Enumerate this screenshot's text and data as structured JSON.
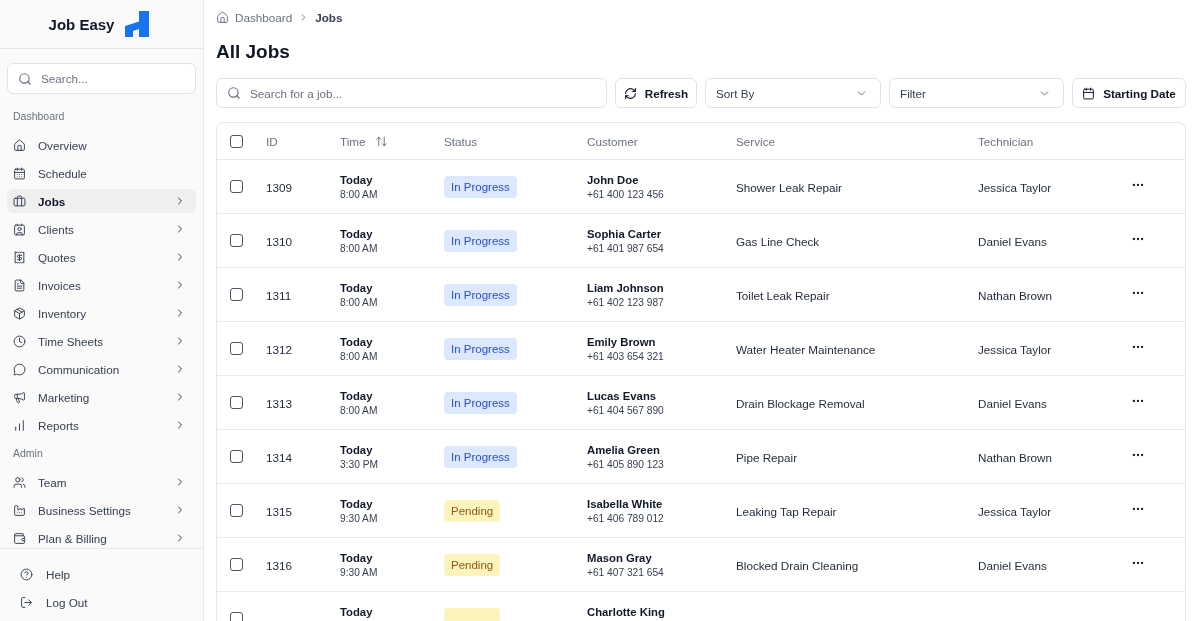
{
  "sidebar": {
    "logo": {
      "text": "Job Easy"
    },
    "search": {
      "placeholder": "Search..."
    },
    "sections": [
      {
        "title": "Dashboard",
        "items": [
          {
            "label": "Overview",
            "selected": false,
            "expandable": false
          },
          {
            "label": "Schedule",
            "selected": false,
            "expandable": false
          },
          {
            "label": "Jobs",
            "selected": true,
            "expandable": true
          },
          {
            "label": "Clients",
            "selected": false,
            "expandable": true
          },
          {
            "label": "Quotes",
            "selected": false,
            "expandable": true
          },
          {
            "label": "Invoices",
            "selected": false,
            "expandable": true
          },
          {
            "label": "Inventory",
            "selected": false,
            "expandable": true
          },
          {
            "label": "Time Sheets",
            "selected": false,
            "expandable": true
          },
          {
            "label": "Communication",
            "selected": false,
            "expandable": true
          },
          {
            "label": "Marketing",
            "selected": false,
            "expandable": true
          },
          {
            "label": "Reports",
            "selected": false,
            "expandable": true
          }
        ]
      },
      {
        "title": "Admin",
        "items": [
          {
            "label": "Team",
            "selected": false,
            "expandable": true
          },
          {
            "label": "Business Settings",
            "selected": false,
            "expandable": true
          },
          {
            "label": "Plan & Billing",
            "selected": false,
            "expandable": true
          }
        ]
      }
    ],
    "footer": [
      {
        "label": "Help"
      },
      {
        "label": "Log Out"
      }
    ]
  },
  "breadcrumb": [
    {
      "label": "Dashboard",
      "current": false
    },
    {
      "label": "Jobs",
      "current": true
    }
  ],
  "page_title": "All Jobs",
  "toolbar": {
    "search": {
      "placeholder": "Search for a job..."
    },
    "refresh_button": "Refresh",
    "sort_select": {
      "placeholder": "Sort By"
    },
    "filter_select": {
      "placeholder": "Filter"
    },
    "date_button": "Starting Date"
  },
  "table": {
    "header_checked": false,
    "columns": [
      {
        "label": "ID",
        "sortable": false
      },
      {
        "label": "Time",
        "sortable": true
      },
      {
        "label": "Status",
        "sortable": false
      },
      {
        "label": "Customer",
        "sortable": false
      },
      {
        "label": "Service",
        "sortable": false
      },
      {
        "label": "Technician",
        "sortable": false
      }
    ],
    "rows": [
      {
        "checked": false,
        "id": "1309",
        "day": "Today",
        "time": "8:00 AM",
        "status": {
          "label": "In Progress",
          "kind": "in_progress"
        },
        "customer": "John Doe",
        "phone": "+61 400 123 456",
        "service": "Shower Leak Repair",
        "technician": "Jessica Taylor"
      },
      {
        "checked": false,
        "id": "1310",
        "day": "Today",
        "time": "8:00 AM",
        "status": {
          "label": "In Progress",
          "kind": "in_progress"
        },
        "customer": "Sophia Carter",
        "phone": "+61 401 987 654",
        "service": "Gas Line Check",
        "technician": "Daniel Evans"
      },
      {
        "checked": false,
        "id": "1311",
        "day": "Today",
        "time": "8:00 AM",
        "status": {
          "label": "In Progress",
          "kind": "in_progress"
        },
        "customer": "Liam Johnson",
        "phone": "+61 402 123 987",
        "service": "Toilet Leak Repair",
        "technician": "Nathan Brown"
      },
      {
        "checked": false,
        "id": "1312",
        "day": "Today",
        "time": "8:00 AM",
        "status": {
          "label": "In Progress",
          "kind": "in_progress"
        },
        "customer": "Emily Brown",
        "phone": "+61 403 654 321",
        "service": "Water Heater Maintenance",
        "technician": "Jessica Taylor"
      },
      {
        "checked": false,
        "id": "1313",
        "day": "Today",
        "time": "8:00 AM",
        "status": {
          "label": "In Progress",
          "kind": "in_progress"
        },
        "customer": "Lucas Evans",
        "phone": "+61 404 567 890",
        "service": "Drain Blockage Removal",
        "technician": "Daniel Evans"
      },
      {
        "checked": false,
        "id": "1314",
        "day": "Today",
        "time": "3:30 PM",
        "status": {
          "label": "In Progress",
          "kind": "in_progress"
        },
        "customer": "Amelia Green",
        "phone": "+61 405 890 123",
        "service": "Pipe Repair",
        "technician": "Nathan Brown"
      },
      {
        "checked": false,
        "id": "1315",
        "day": "Today",
        "time": "9:30 AM",
        "status": {
          "label": "Pending",
          "kind": "pending"
        },
        "customer": "Isabella White",
        "phone": "+61 406 789 012",
        "service": "Leaking Tap Repair",
        "technician": "Jessica Taylor"
      },
      {
        "checked": false,
        "id": "1316",
        "day": "Today",
        "time": "9:30 AM",
        "status": {
          "label": "Pending",
          "kind": "pending"
        },
        "customer": "Mason Gray",
        "phone": "+61 407 321 654",
        "service": "Blocked Drain Cleaning",
        "technician": "Daniel Evans"
      },
      {
        "checked": false,
        "day": "Today",
        "status": {
          "kind": "pending"
        },
        "customer": "Charlotte King"
      }
    ]
  }
}
